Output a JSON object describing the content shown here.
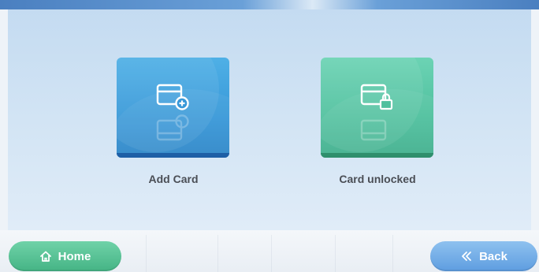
{
  "tiles": [
    {
      "label": "Add Card",
      "icon": "card-add-icon",
      "color": "#3898d8"
    },
    {
      "label": "Card unlocked",
      "icon": "card-lock-icon",
      "color": "#4fc09e"
    }
  ],
  "nav": {
    "home_label": "Home",
    "home_icon": "home-icon",
    "back_label": "Back",
    "back_icon": "double-chevron-left-icon"
  },
  "colors": {
    "accent_blue": "#3898d8",
    "accent_green": "#4fc09e",
    "home_button": "#45b485",
    "back_button": "#5e9de0"
  }
}
